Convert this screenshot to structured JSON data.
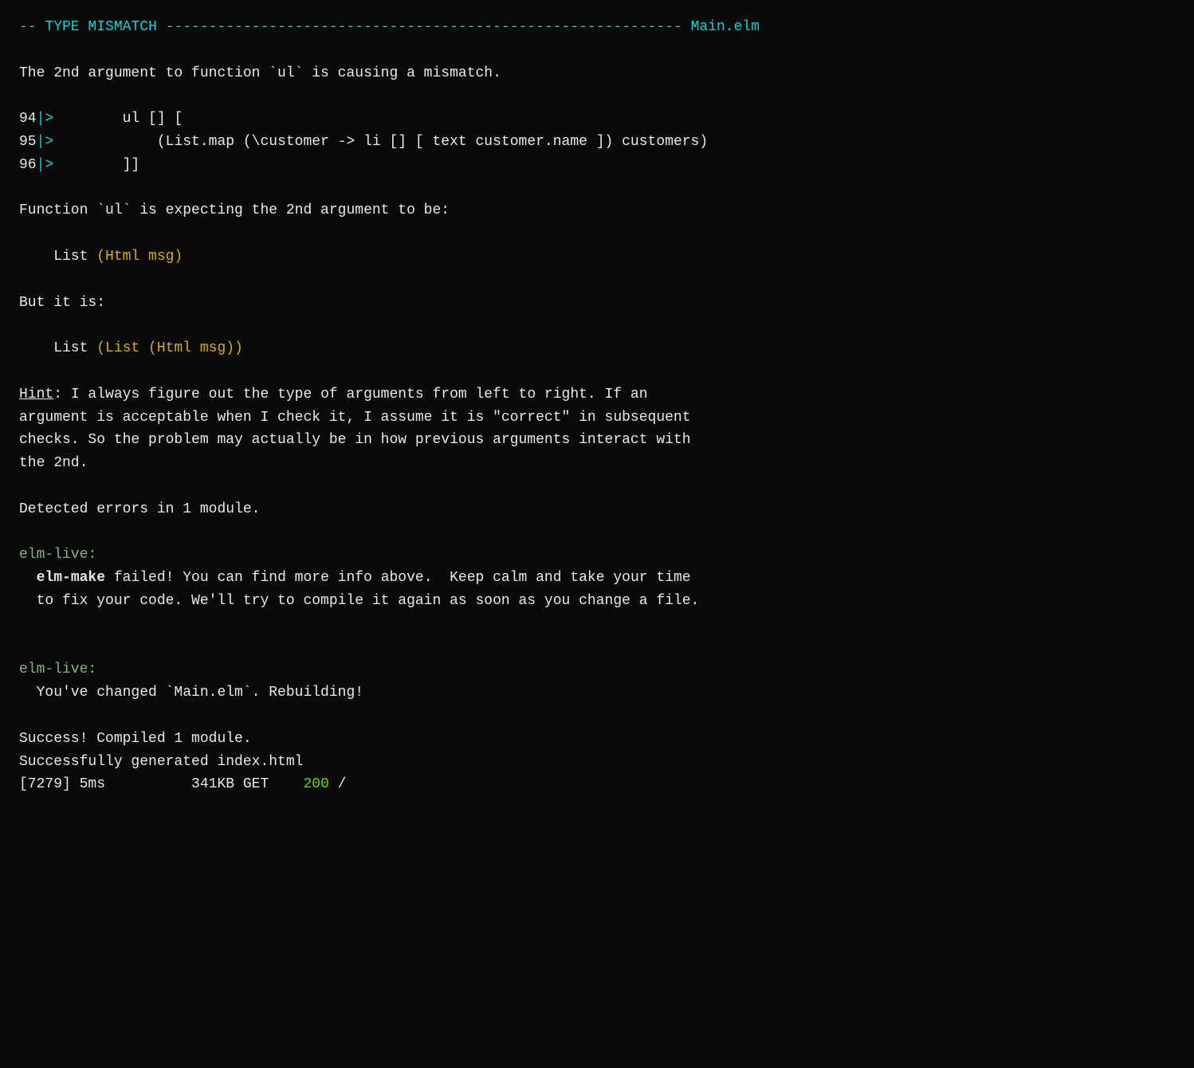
{
  "terminal": {
    "header": {
      "prefix": "-- TYPE MISMATCH ",
      "dashes": "------------------------------------------------------------",
      "filename": "Main.elm"
    },
    "error_description": "The 2nd argument to function `ul` is causing a mismatch.",
    "code_lines": [
      {
        "number": "94",
        "prompt": "|>",
        "content": "        ul [] ["
      },
      {
        "number": "95",
        "prompt": "|>",
        "content": "            (List.map (\\customer -> li [] [ text customer.name ]) customers)"
      },
      {
        "number": "96",
        "prompt": "|>",
        "content": "        ]]"
      }
    ],
    "expecting_label": "Function `ul` is expecting the 2nd argument to be:",
    "expected_type_prefix": "    List ",
    "expected_type_colored": "(Html msg)",
    "but_it_is_label": "But it is:",
    "actual_type_prefix": "    List ",
    "actual_type_colored": "(List (Html msg))",
    "hint_label": "Hint",
    "hint_text": ": I always figure out the type of arguments from left to right. If an\nargument is acceptable when I check it, I assume it is \"correct\" in subsequent\nchecks. So the problem may actually be in how previous arguments interact with\nthe 2nd.",
    "detected_errors": "Detected errors in 1 module.",
    "elm_live_prefix1": "elm-live:",
    "elm_make_bold": "elm-make",
    "elm_make_message": " failed! You can find more info above.  Keep calm and take your time\n  to fix your code. We'll try to compile it again as soon as you change a file.",
    "elm_live_prefix2": "elm-live:",
    "rebuild_message": "  You've changed `Main.elm`. Rebuilding!",
    "success_line1": "Success! Compiled 1 module.",
    "success_line2": "Successfully generated index.html",
    "request_line": "[7279] 5ms          341KB GET",
    "status_code": "200",
    "request_path": " /"
  }
}
